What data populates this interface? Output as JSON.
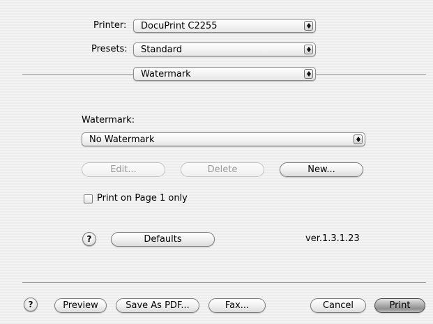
{
  "printer": {
    "label": "Printer:",
    "value": "DocuPrint C2255"
  },
  "presets": {
    "label": "Presets:",
    "value": "Standard"
  },
  "panel": {
    "value": "Watermark"
  },
  "watermark": {
    "label": "Watermark:",
    "value": "No Watermark",
    "edit_label": "Edit...",
    "delete_label": "Delete",
    "new_label": "New...",
    "page1_label": "Print on Page 1 only",
    "page1_checked": false
  },
  "defaults": {
    "help_label": "?",
    "defaults_label": "Defaults",
    "version": "ver.1.3.1.23"
  },
  "footer": {
    "help_label": "?",
    "preview_label": "Preview",
    "save_pdf_label": "Save As PDF...",
    "fax_label": "Fax...",
    "cancel_label": "Cancel",
    "print_label": "Print"
  }
}
